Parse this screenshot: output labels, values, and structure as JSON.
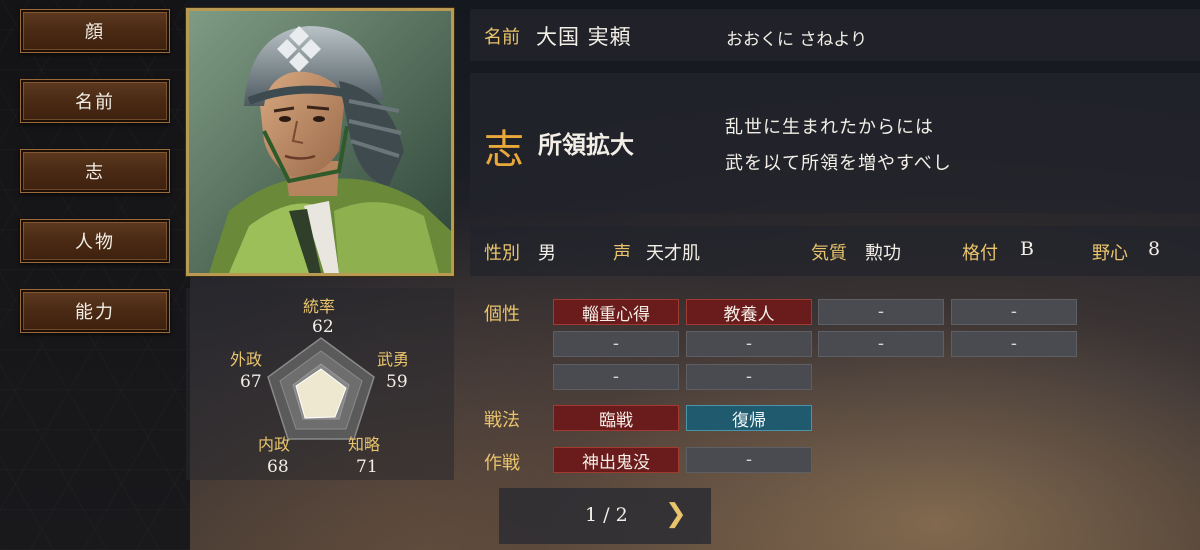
{
  "sidebar": {
    "items": [
      {
        "label": "顔"
      },
      {
        "label": "名前"
      },
      {
        "label": "志"
      },
      {
        "label": "人物"
      },
      {
        "label": "能力"
      }
    ]
  },
  "stats": {
    "tousotsu": {
      "label": "統率",
      "value": "62"
    },
    "buyu": {
      "label": "武勇",
      "value": "59"
    },
    "chiryaku": {
      "label": "知略",
      "value": "71"
    },
    "naisei": {
      "label": "内政",
      "value": "68"
    },
    "gaisei": {
      "label": "外政",
      "value": "67"
    }
  },
  "name": {
    "label": "名前",
    "kanji": "大国 実頼",
    "reading": "おおくに さねより"
  },
  "ambition": {
    "glyph": "志",
    "title": "所領拡大",
    "line1": "乱世に生まれたからには",
    "line2": "武を以て所領を増やすべし"
  },
  "profile": {
    "gender_label": "性別",
    "gender": "男",
    "voice_label": "声",
    "voice": "天才肌",
    "temper_label": "気質",
    "temper": "勲功",
    "rank_label": "格付",
    "rank": "B",
    "ambition_label": "野心",
    "ambition": "8"
  },
  "traits": {
    "label": "個性",
    "items": [
      "輜重心得",
      "教養人",
      "-",
      "-",
      "-",
      "-",
      "-",
      "-",
      "-",
      "-"
    ]
  },
  "tactics": {
    "label": "戦法",
    "items": [
      "臨戦",
      "復帰"
    ]
  },
  "strategy": {
    "label": "作戦",
    "items": [
      "神出鬼没",
      "-"
    ]
  },
  "pager": {
    "text": "1 / 2",
    "next_glyph": "❯"
  },
  "colors": {
    "gold": "#e9c46c",
    "trait_red": "#6a1b1b",
    "tactic_blue": "#1f5a6e",
    "empty_grey": "#4a4b50"
  }
}
